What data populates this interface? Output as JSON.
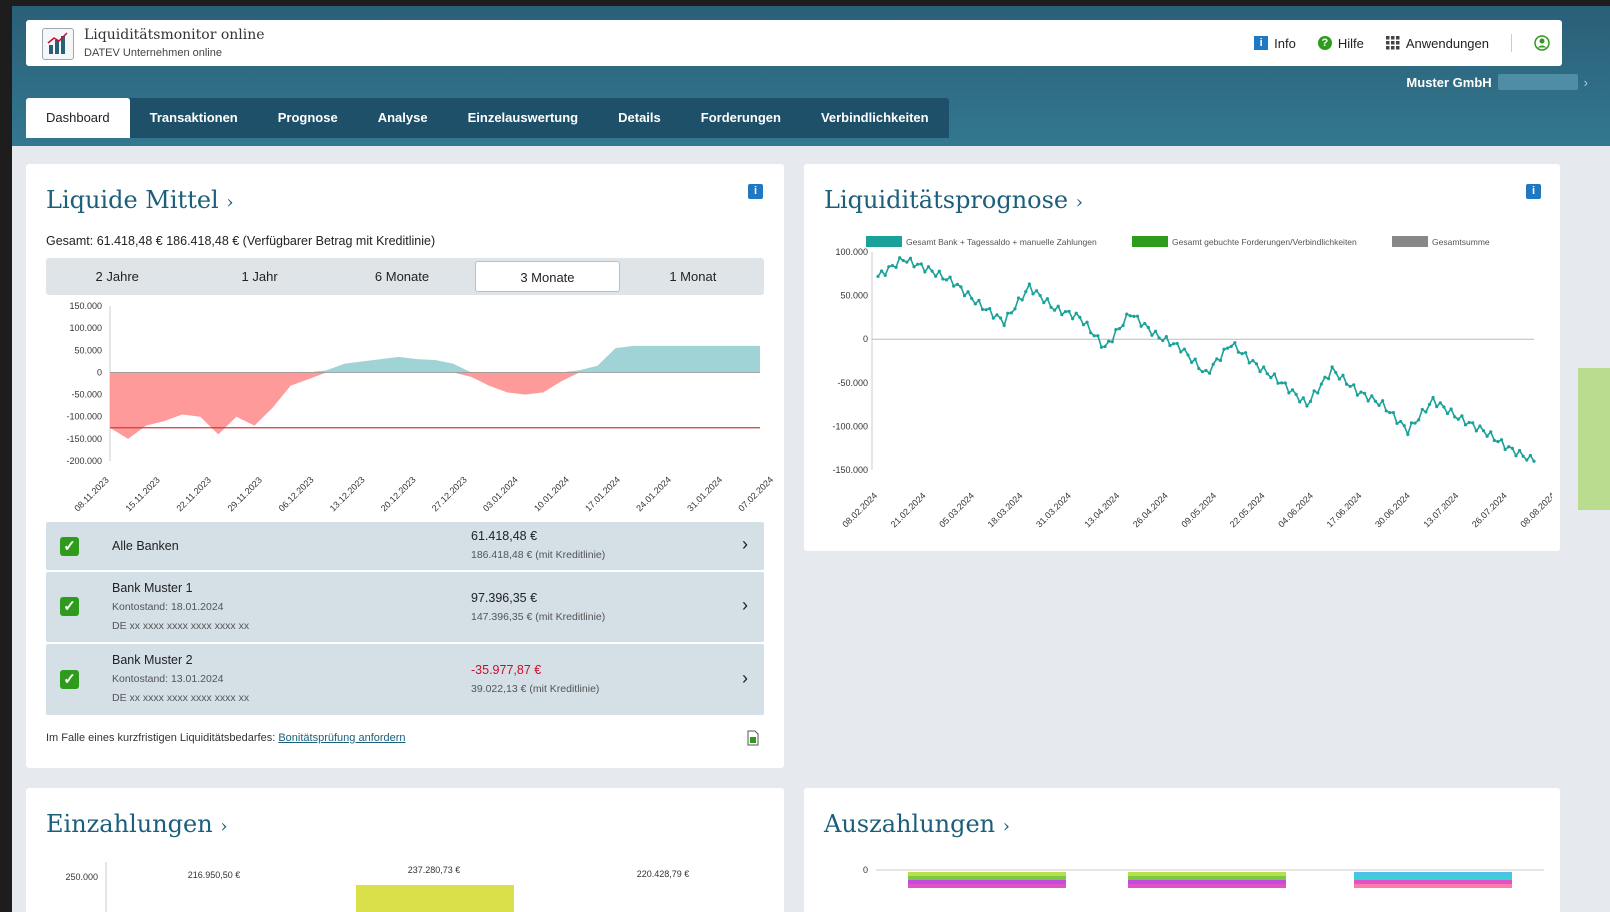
{
  "app": {
    "title": "Liquiditätsmonitor online",
    "subtitle": "DATEV Unternehmen online"
  },
  "top_actions": {
    "info": "Info",
    "help": "Hilfe",
    "apps": "Anwendungen"
  },
  "company": {
    "name": "Muster GmbH",
    "chevron": "›"
  },
  "tabs": [
    {
      "label": "Dashboard",
      "active": true
    },
    {
      "label": "Transaktionen"
    },
    {
      "label": "Prognose"
    },
    {
      "label": "Analyse"
    },
    {
      "label": "Einzelauswertung"
    },
    {
      "label": "Details"
    },
    {
      "label": "Forderungen"
    },
    {
      "label": "Verbindlichkeiten"
    }
  ],
  "liquide": {
    "title": "Liquide Mittel",
    "title_chevron": "›",
    "info_badge": "i",
    "total": "Gesamt: 61.418,48 € 186.418,48 € (Verfügbarer Betrag mit Kreditlinie)",
    "periods": [
      "2 Jahre",
      "1 Jahr",
      "6 Monate",
      "3 Monate",
      "1 Monat"
    ],
    "active_period": "3 Monate",
    "banks": [
      {
        "name": "Alle Banken",
        "amount": "61.418,48 €",
        "credit": "186.418,48 € (mit Kreditlinie)",
        "checked": true
      },
      {
        "name": "Bank Muster 1",
        "date": "Kontostand: 18.01.2024",
        "iban": "DE xx xxxx xxxx xxxx xxxx xx",
        "amount": "97.396,35 €",
        "credit": "147.396,35 € (mit Kreditlinie)",
        "checked": true
      },
      {
        "name": "Bank Muster 2",
        "date": "Kontostand: 13.01.2024",
        "iban": "DE xx xxxx xxxx xxxx xxxx xx",
        "amount": "-35.977,87 €",
        "credit": "39.022,13 € (mit Kreditlinie)",
        "checked": true,
        "negative": true
      }
    ],
    "footnote_text": "Im Falle eines kurzfristigen Liquiditätsbedarfes:",
    "footnote_link": "Bonitätsprüfung anfordern"
  },
  "prognose": {
    "title": "Liquiditätsprognose",
    "title_chevron": "›",
    "info_badge": "i"
  },
  "einzahlungen": {
    "title": "Einzahlungen",
    "title_chevron": "›"
  },
  "auszahlungen": {
    "title": "Auszahlungen",
    "title_chevron": "›"
  },
  "colors": {
    "header": "#2a5f78",
    "tab_bg": "#1f5069",
    "title": "#1b5f7a",
    "positive_area": "#9fd3d6",
    "negative_area": "#ff9a9a",
    "credit_line": "#d23b3b",
    "forecast_line": "#1aa29a",
    "check": "#2e9b1d"
  },
  "chart_data": [
    {
      "type": "area",
      "ylim": [
        -200000,
        150000
      ],
      "yticks": [
        "150.000",
        "100.000",
        "50.000",
        "0",
        "-50.000",
        "-100.000",
        "-150.000",
        "-200.000"
      ],
      "categories": [
        "08.11.2023",
        "15.11.2023",
        "22.11.2023",
        "29.11.2023",
        "06.12.2023",
        "13.12.2023",
        "20.12.2023",
        "27.12.2023",
        "03.01.2024",
        "10.01.2024",
        "17.01.2024",
        "24.01.2024",
        "31.01.2024",
        "07.02.2024"
      ],
      "credit_line": -125000,
      "values": [
        -125000,
        -150000,
        -120000,
        -110000,
        -95000,
        -100000,
        -140000,
        -100000,
        -120000,
        -80000,
        -30000,
        -15000,
        5000,
        20000,
        25000,
        30000,
        35000,
        30000,
        28000,
        20000,
        -10000,
        -30000,
        -45000,
        -50000,
        -45000,
        -20000,
        5000,
        15000,
        55000,
        60000,
        60000,
        60000,
        60000,
        60000,
        60000,
        60000,
        60000
      ]
    },
    {
      "type": "line",
      "ylim": [
        -150000,
        100000
      ],
      "yticks": [
        "100.000",
        "50.000",
        "0",
        "-50.000",
        "-100.000",
        "-150.000"
      ],
      "categories": [
        "08.02.2024",
        "21.02.2024",
        "05.03.2024",
        "18.03.2024",
        "31.03.2024",
        "13.04.2024",
        "26.04.2024",
        "09.05.2024",
        "22.05.2024",
        "04.06.2024",
        "17.06.2024",
        "30.06.2024",
        "13.07.2024",
        "26.07.2024",
        "08.08.2024"
      ],
      "legend": [
        "Gesamt Bank + Tagessaldo + manuelle Zahlungen",
        "Gesamt gebuchte Forderungen/Verbindlichkeiten",
        "Gesamtsumme"
      ],
      "legend_colors": [
        "#1aa29a",
        "#2e9b1d",
        "#888888"
      ],
      "series": [
        {
          "name": "Gesamt Bank + Tagessaldo + manuelle Zahlungen",
          "values": [
            72000,
            92000,
            80000,
            65000,
            40000,
            20000,
            60000,
            35000,
            25000,
            -10000,
            30000,
            5000,
            -10000,
            -40000,
            -5000,
            -30000,
            -50000,
            -75000,
            -35000,
            -60000,
            -75000,
            -105000,
            -70000,
            -90000,
            -105000,
            -125000,
            -140000
          ]
        }
      ]
    },
    {
      "type": "bar",
      "ylim": [
        0,
        250000
      ],
      "yticks": [
        "250.000"
      ],
      "data_labels": [
        "216.950,50 €",
        "237.280,73 €",
        "220.428,79 €"
      ],
      "values": [
        216950.5,
        237280.73,
        220428.79
      ]
    },
    {
      "type": "bar",
      "yticks": [
        "0"
      ]
    }
  ]
}
